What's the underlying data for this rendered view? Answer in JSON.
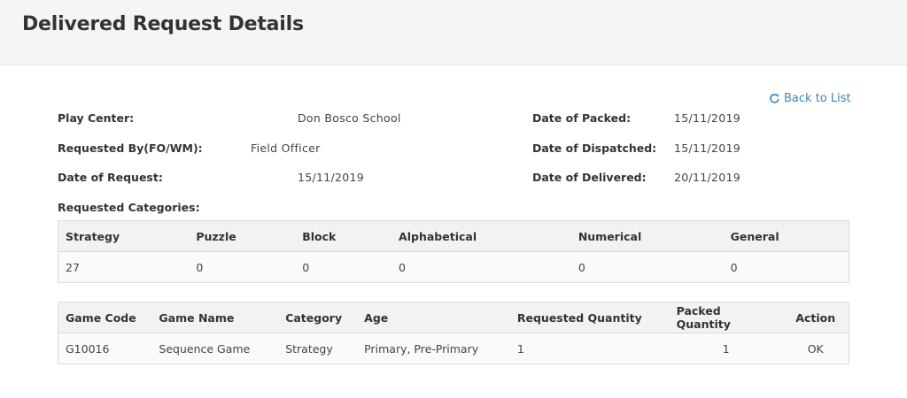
{
  "header": {
    "title": "Delivered Request Details"
  },
  "back_link": {
    "label": "Back to List",
    "icon": "refresh-icon",
    "color": "#3c84c4"
  },
  "details": {
    "play_center": {
      "label": "Play Center:",
      "value": "Don Bosco School"
    },
    "requested_by": {
      "label": "Requested By(FO/WM):",
      "value": "Field Officer"
    },
    "date_of_request": {
      "label": "Date of Request:",
      "value": "15/11/2019"
    },
    "date_of_packed": {
      "label": "Date of Packed:",
      "value": "15/11/2019"
    },
    "date_of_dispatched": {
      "label": "Date of Dispatched:",
      "value": "15/11/2019"
    },
    "date_of_delivered": {
      "label": "Date of Delivered:",
      "value": "20/11/2019"
    },
    "requested_categories_label": "Requested Categories:"
  },
  "categories_table": {
    "headers": [
      "Strategy",
      "Puzzle",
      "Block",
      "Alphabetical",
      "Numerical",
      "General"
    ],
    "rows": [
      [
        "27",
        "0",
        "0",
        "0",
        "0",
        "0"
      ]
    ]
  },
  "games_table": {
    "headers": [
      "Game Code",
      "Game Name",
      "Category",
      "Age",
      "Requested Quantity",
      "Packed Quantity",
      "Action"
    ],
    "rows": [
      [
        "G10016",
        "Sequence Game",
        "Strategy",
        "Primary, Pre-Primary",
        "1",
        "1",
        "OK"
      ]
    ]
  }
}
